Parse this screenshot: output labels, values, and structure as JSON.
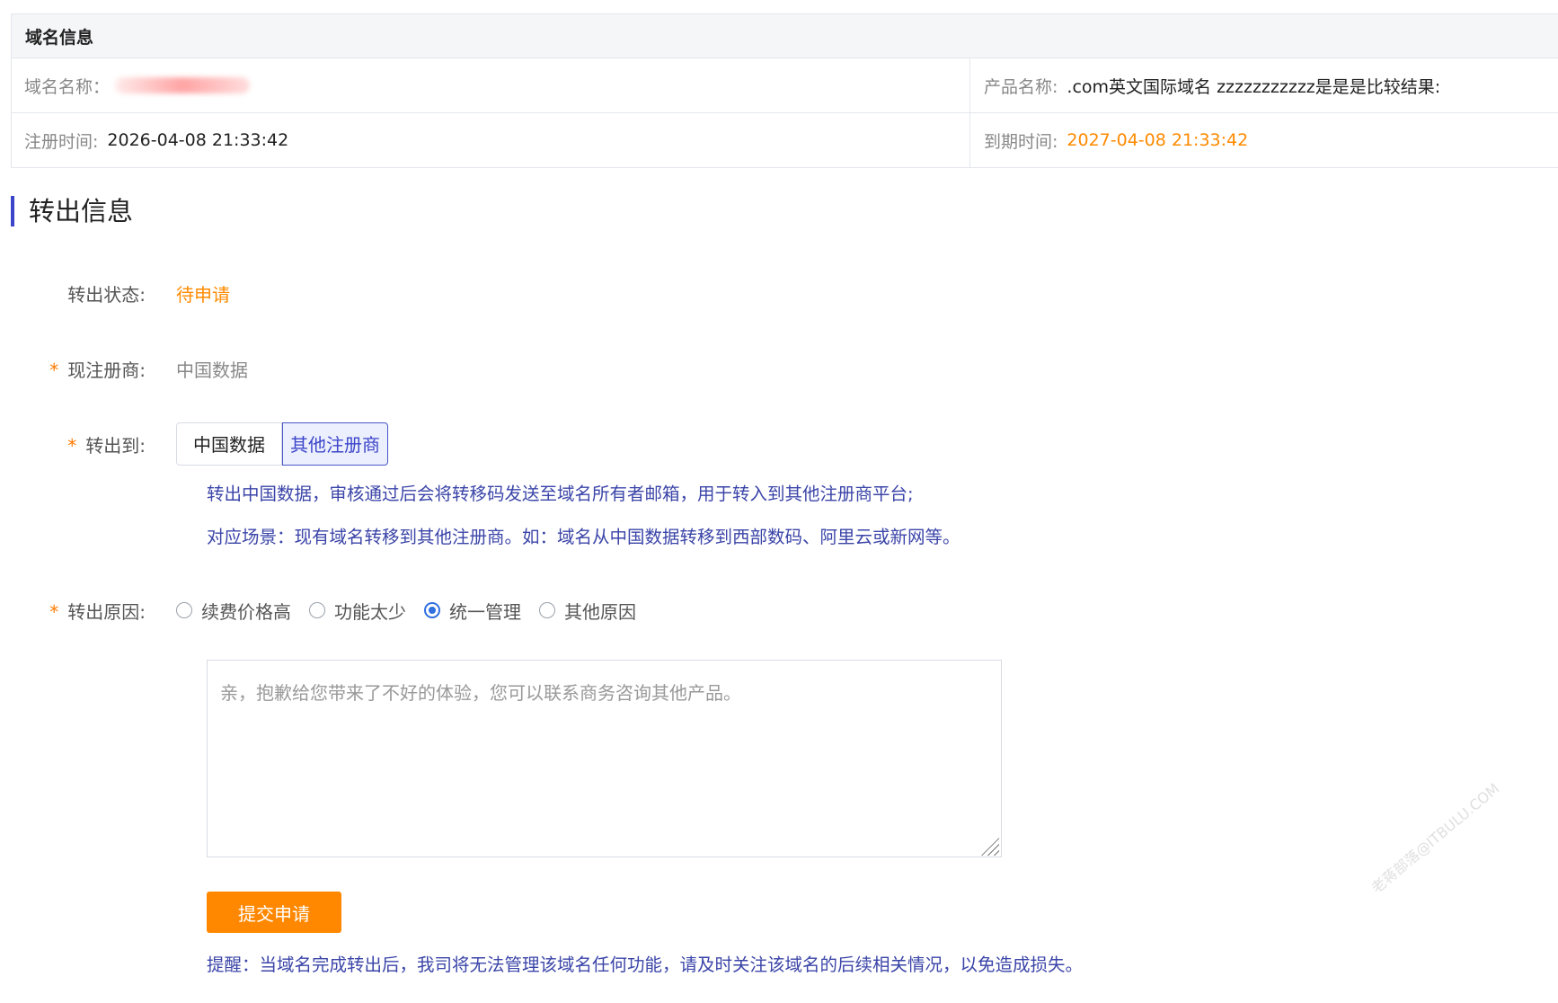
{
  "domain_info": {
    "header": "域名信息",
    "domain_name_label": "域名名称：",
    "product_name_label": "产品名称:",
    "product_name_value": ".com英文国际域名 zzzzzzzzzzz是是是比较结果:",
    "register_time_label": "注册时间:",
    "register_time_value": "2026-04-08 21:33:42",
    "expire_time_label": "到期时间:",
    "expire_time_value": "2027-04-08 21:33:42"
  },
  "transfer": {
    "section_title": "转出信息",
    "status_label": "转出状态:",
    "status_value": "待申请",
    "required_mark": "*",
    "current_registrar_label": "现注册商:",
    "current_registrar_value": "中国数据",
    "transfer_to_label": "转出到:",
    "transfer_to_options": [
      "中国数据",
      "其他注册商"
    ],
    "transfer_to_selected": "其他注册商",
    "hint_line1": "转出中国数据，审核通过后会将转移码发送至域名所有者邮箱，用于转入到其他注册商平台;",
    "hint_line2": "对应场景：现有域名转移到其他注册商。如：域名从中国数据转移到西部数码、阿里云或新网等。",
    "reason_label": "转出原因:",
    "reasons": [
      "续费价格高",
      "功能太少",
      "统一管理",
      "其他原因"
    ],
    "reason_selected": "统一管理",
    "textarea_placeholder": "亲，抱歉给您带来了不好的体验，您可以联系商务咨询其他产品。",
    "submit_label": "提交申请",
    "reminder": "提醒：当域名完成转出后，我司将无法管理该域名任何功能，请及时关注该域名的后续相关情况，以免造成损失。"
  },
  "watermark": "老蒋部落@ITBULU.COM"
}
